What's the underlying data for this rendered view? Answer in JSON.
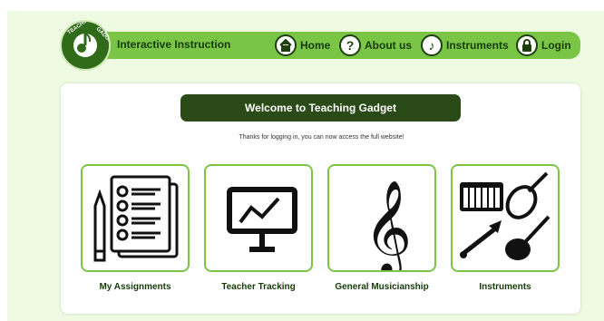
{
  "nav": {
    "brand": "Interactive Instruction",
    "logo_text": "TEACHING GADGET",
    "items": [
      {
        "label": "Home",
        "icon": "home-icon"
      },
      {
        "label": "About us",
        "icon": "question-icon"
      },
      {
        "label": "Instruments",
        "icon": "music-note-icon"
      },
      {
        "label": "Login",
        "icon": "lock-icon"
      }
    ]
  },
  "main": {
    "welcome": "Welcome to Teaching Gadget",
    "subtitle": "Thanks for logging in, you can now access the full website!",
    "tiles": [
      {
        "label": "My Assignments",
        "icon": "checklist-icon"
      },
      {
        "label": "Teacher Tracking",
        "icon": "chart-presentation-icon"
      },
      {
        "label": "General Musicianship",
        "icon": "treble-clef-icon"
      },
      {
        "label": "Instruments",
        "icon": "instruments-icon"
      }
    ]
  },
  "colors": {
    "accent_green": "#7ac545",
    "dark_green": "#2a4b17",
    "background": "#eefbe2"
  }
}
